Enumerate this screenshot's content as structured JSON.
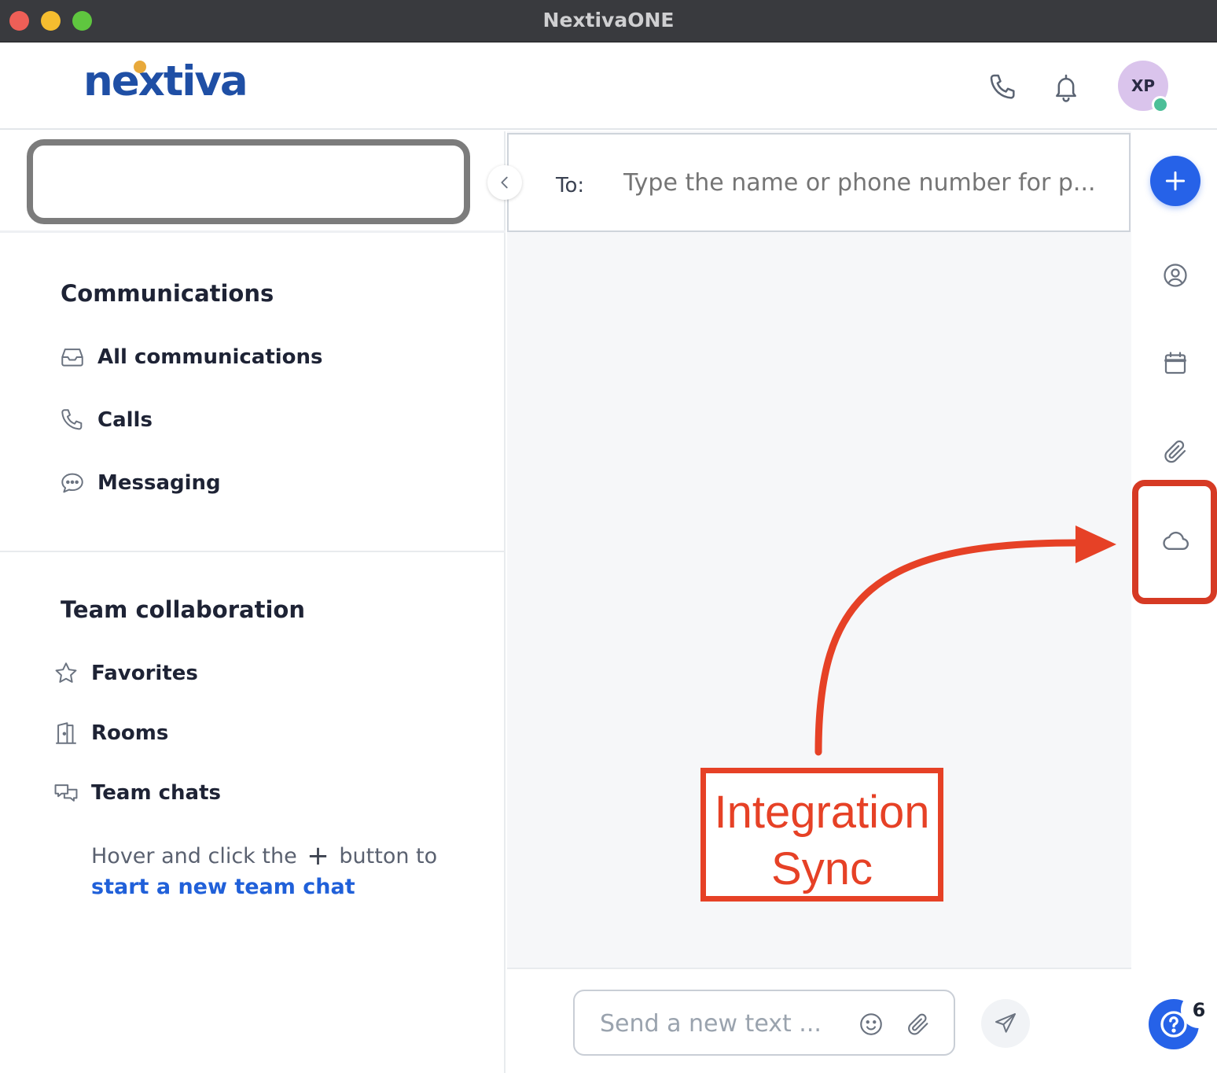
{
  "window": {
    "title": "NextivaONE"
  },
  "header": {
    "logo_text": "nextiva",
    "icons": [
      "phone-icon",
      "bell-icon"
    ],
    "avatar_initials": "XP",
    "presence_color": "#4cbf98"
  },
  "sidebar": {
    "search_value": "",
    "communications": {
      "title": "Communications",
      "items": [
        {
          "label": "All communications",
          "icon": "inbox-icon"
        },
        {
          "label": "Calls",
          "icon": "phone-icon"
        },
        {
          "label": "Messaging",
          "icon": "chat-bubble-icon"
        }
      ]
    },
    "team": {
      "title": "Team collaboration",
      "items": [
        {
          "label": "Favorites",
          "icon": "star-icon"
        },
        {
          "label": "Rooms",
          "icon": "door-icon"
        },
        {
          "label": "Team chats",
          "icon": "chats-icon"
        }
      ],
      "hint_before": "Hover and click the",
      "hint_plus": "+",
      "hint_after": "button to",
      "hint_link": "start a new team chat"
    }
  },
  "main": {
    "to_label": "To:",
    "to_placeholder": "Type the name or phone number for p...",
    "composer_placeholder": "Send a new text ..."
  },
  "rail": {
    "icons": [
      "add-icon",
      "contact-icon",
      "calendar-icon",
      "paperclip-icon",
      "cloud-icon",
      "help-icon"
    ],
    "help_badge": "6"
  },
  "annotation": {
    "text_line1": "Integration",
    "text_line2": "Sync",
    "color": "#e64126"
  },
  "colors": {
    "accent": "#2662e8",
    "link": "#2060d9",
    "logo": "#1f4fa5"
  }
}
